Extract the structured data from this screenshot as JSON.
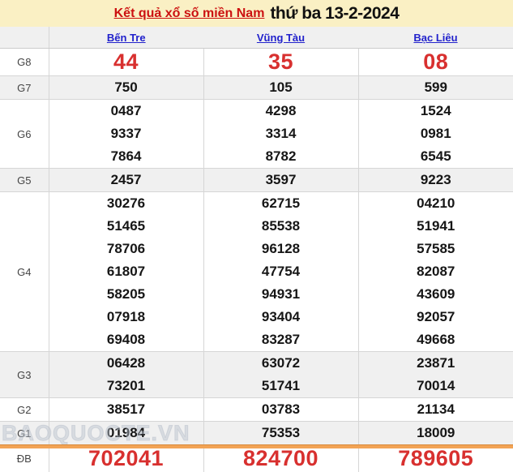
{
  "header": {
    "title_link": "Kết quả xổ số miền Nam",
    "title_date": "thứ ba 13-2-2024"
  },
  "columns": [
    "Bến Tre",
    "Vũng Tàu",
    "Bạc Liêu"
  ],
  "prizes": [
    {
      "label": "G8",
      "highlight": true,
      "lines": [
        [
          "44",
          "35",
          "08"
        ]
      ]
    },
    {
      "label": "G7",
      "highlight": false,
      "lines": [
        [
          "750",
          "105",
          "599"
        ]
      ]
    },
    {
      "label": "G6",
      "highlight": false,
      "lines": [
        [
          "0487",
          "4298",
          "1524"
        ],
        [
          "9337",
          "3314",
          "0981"
        ],
        [
          "7864",
          "8782",
          "6545"
        ]
      ]
    },
    {
      "label": "G5",
      "highlight": false,
      "lines": [
        [
          "2457",
          "3597",
          "9223"
        ]
      ]
    },
    {
      "label": "G4",
      "highlight": false,
      "lines": [
        [
          "30276",
          "62715",
          "04210"
        ],
        [
          "51465",
          "85538",
          "51941"
        ],
        [
          "78706",
          "96128",
          "57585"
        ],
        [
          "61807",
          "47754",
          "82087"
        ],
        [
          "58205",
          "94931",
          "43609"
        ],
        [
          "07918",
          "93404",
          "92057"
        ],
        [
          "69408",
          "83287",
          "49668"
        ]
      ]
    },
    {
      "label": "G3",
      "highlight": false,
      "lines": [
        [
          "06428",
          "63072",
          "23871"
        ],
        [
          "73201",
          "51741",
          "70014"
        ]
      ]
    },
    {
      "label": "G2",
      "highlight": false,
      "lines": [
        [
          "38517",
          "03783",
          "21134"
        ]
      ]
    },
    {
      "label": "G1",
      "highlight": false,
      "lines": [
        [
          "01984",
          "75353",
          "18009"
        ]
      ]
    },
    {
      "label": "ĐB",
      "highlight": true,
      "lines": [
        [
          "702041",
          "824700",
          "789605"
        ]
      ]
    }
  ],
  "watermark": "BAOQUOCTE.VN",
  "colors": {
    "title_band_bg": "#faf0c4",
    "title_link_red": "#cc1111",
    "column_link_blue": "#2222cc",
    "highlight_number_red": "#d8302f",
    "row_shade_gray": "#f0f0f0",
    "border_gray": "#d6d6d6",
    "bottom_bar_orange": "#f2a355"
  }
}
